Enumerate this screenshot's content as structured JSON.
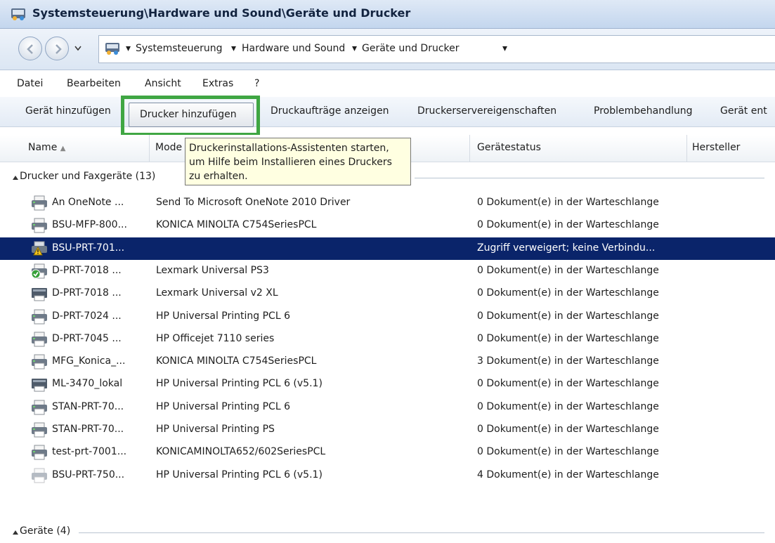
{
  "window": {
    "title": "Systemsteuerung\\Hardware und Sound\\Geräte und Drucker"
  },
  "address": {
    "crumbs": [
      "Systemsteuerung",
      "Hardware und Sound",
      "Geräte und Drucker"
    ]
  },
  "menu": {
    "items": [
      "Datei",
      "Bearbeiten",
      "Ansicht",
      "Extras",
      "?"
    ]
  },
  "toolbar": {
    "add_device": "Gerät hinzufügen",
    "add_printer": "Drucker hinzufügen",
    "show_jobs": "Druckaufträge anzeigen",
    "server_props": "Druckerservereigenschaften",
    "troubleshoot": "Problembehandlung",
    "remove_device": "Gerät ent"
  },
  "columns": {
    "name": "Name",
    "model": "Mode",
    "status": "Gerätestatus",
    "manufacturer": "Hersteller"
  },
  "tooltip": {
    "line1": "Druckerinstallations-Assistenten starten,",
    "line2": "um Hilfe beim Installieren eines Druckers",
    "line3": "zu erhalten."
  },
  "groups": {
    "printers": "Drucker und Faxgeräte (13)",
    "devices": "Geräte (4)"
  },
  "printers": [
    {
      "name": "An OneNote ...",
      "model": "Send To Microsoft OneNote 2010 Driver",
      "status": "0 Dokument(e) in der Warteschlange",
      "icon": "printer-icon"
    },
    {
      "name": "BSU-MFP-800...",
      "model": "KONICA MINOLTA C754SeriesPCL",
      "status": "0 Dokument(e) in der Warteschlange",
      "icon": "printer-icon"
    },
    {
      "name": "BSU-PRT-701...",
      "model": "",
      "status": "Zugriff verweigert; keine Verbindu...",
      "icon": "printer-warning-icon",
      "selected": true
    },
    {
      "name": "D-PRT-7018 ...",
      "model": "Lexmark Universal PS3",
      "status": "0 Dokument(e) in der Warteschlange",
      "icon": "default-printer-icon"
    },
    {
      "name": "D-PRT-7018 ...",
      "model": "Lexmark Universal v2 XL",
      "status": "0 Dokument(e) in der Warteschlange",
      "icon": "laser-printer-icon"
    },
    {
      "name": "D-PRT-7024 ...",
      "model": "HP Universal Printing PCL 6",
      "status": "0 Dokument(e) in der Warteschlange",
      "icon": "printer-icon"
    },
    {
      "name": "D-PRT-7045 ...",
      "model": "HP Officejet 7110 series",
      "status": "0 Dokument(e) in der Warteschlange",
      "icon": "printer-icon"
    },
    {
      "name": "MFG_Konica_...",
      "model": "KONICA MINOLTA C754SeriesPCL",
      "status": "3 Dokument(e) in der Warteschlange",
      "icon": "printer-icon"
    },
    {
      "name": "ML-3470_lokal",
      "model": "HP Universal Printing PCL 6 (v5.1)",
      "status": "0 Dokument(e) in der Warteschlange",
      "icon": "laser-printer-icon"
    },
    {
      "name": "STAN-PRT-70...",
      "model": "HP Universal Printing PCL 6",
      "status": "0 Dokument(e) in der Warteschlange",
      "icon": "printer-icon"
    },
    {
      "name": "STAN-PRT-70...",
      "model": "HP Universal Printing PS",
      "status": "0 Dokument(e) in der Warteschlange",
      "icon": "printer-icon"
    },
    {
      "name": "test-prt-7001...",
      "model": "KONICAMINOLTA652/602SeriesPCL",
      "status": "0 Dokument(e) in der Warteschlange",
      "icon": "printer-icon"
    },
    {
      "name": "BSU-PRT-750...",
      "model": "HP Universal Printing PCL 6 (v5.1)",
      "status": "4 Dokument(e) in der Warteschlange",
      "icon": "printer-offline-icon"
    }
  ],
  "colors": {
    "selection": "#0a246a",
    "highlight_box": "#3fa643",
    "tooltip_bg": "#ffffe1"
  }
}
